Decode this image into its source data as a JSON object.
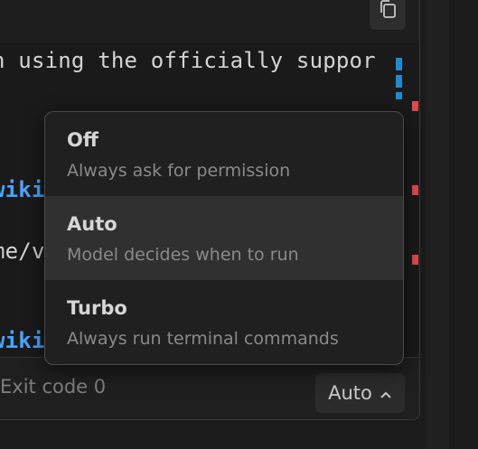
{
  "code_lines": {
    "line1": "n using the officially suppor",
    "line2": "wiki",
    "line3": "me/v",
    "line4": "wiki"
  },
  "footer": {
    "exit_text": "Exit code 0",
    "mode_label": "Auto"
  },
  "dropdown": {
    "options": [
      {
        "title": "Off",
        "description": "Always ask for permission"
      },
      {
        "title": "Auto",
        "description": "Model decides when to run"
      },
      {
        "title": "Turbo",
        "description": "Always run terminal commands"
      }
    ],
    "selected": "Auto"
  },
  "icons": {
    "copy": "copy-icon",
    "chevron": "chevron-up-icon"
  },
  "colors": {
    "link": "#4aa3ff",
    "scroll_marker_blue": "#1f8ad2",
    "scroll_marker_red": "#e04b4b",
    "selected_row": "#303030"
  }
}
